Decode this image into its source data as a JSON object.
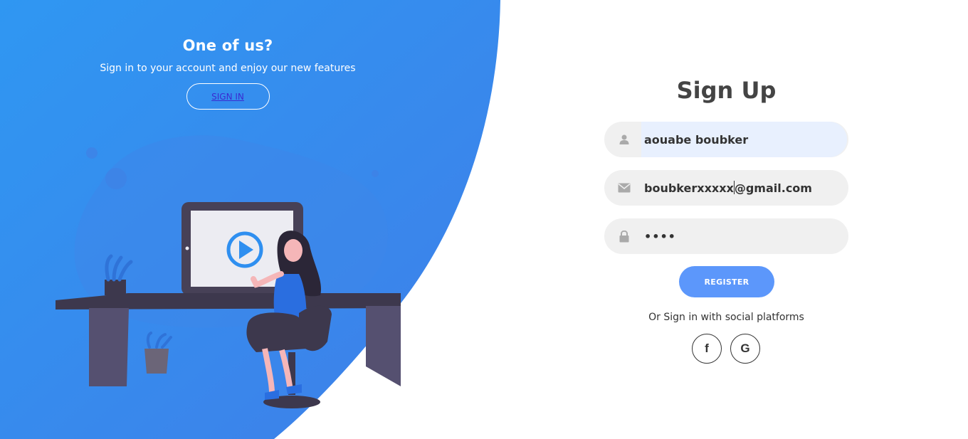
{
  "left_panel": {
    "title": "One of us?",
    "subtitle": "Sign in to your account and enjoy our new features",
    "signin_label": "SIGN IN"
  },
  "form": {
    "title": "Sign Up",
    "name_value": "aouabe boubker",
    "email_value_before_caret": "boubkerxxxxx",
    "email_value_after_caret": "@gmail.com",
    "password_dots": "••••",
    "register_label": "REGISTER",
    "social_text": "Or Sign in with social platforms",
    "facebook_glyph": "f",
    "google_glyph": "G"
  },
  "icons": {
    "name": "user-icon",
    "email": "envelope-icon",
    "password": "lock-icon",
    "play": "play-icon"
  },
  "colors": {
    "accent_blue": "#2f8ff0",
    "register_button": "#5c97fb",
    "field_bg": "#f0f0f0",
    "autofill_bg": "#e8f0fe"
  }
}
